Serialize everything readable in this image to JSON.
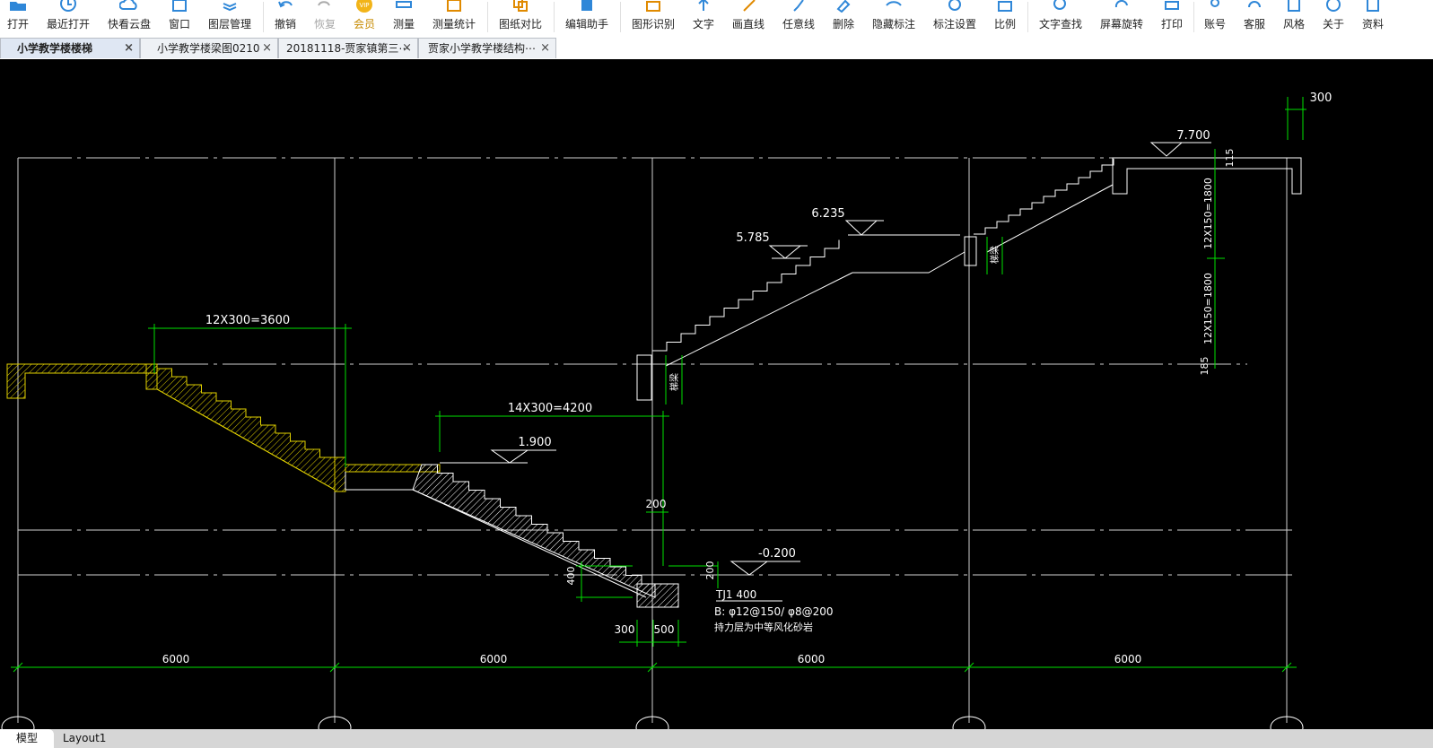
{
  "toolbar": {
    "open": "打开",
    "recent": "最近打开",
    "cloud": "快看云盘",
    "window": "窗口",
    "layers": "图层管理",
    "undo": "撤销",
    "redo": "恢复",
    "vip": "会员",
    "measure": "测量",
    "measure_stats": "测量统计",
    "compare": "图纸对比",
    "edit_assistant": "编辑助手",
    "shape_recognize": "图形识别",
    "text": "文字",
    "line": "画直线",
    "freeline": "任意线",
    "delete": "删除",
    "hide_dim": "隐藏标注",
    "dim_settings": "标注设置",
    "scale": "比例",
    "text_search": "文字查找",
    "rotate": "屏幕旋转",
    "print": "打印",
    "account": "账号",
    "service": "客服",
    "style": "风格",
    "about": "关于",
    "resources": "资料",
    "vip_badge": "VIP"
  },
  "tabs": [
    {
      "label": "小学教学楼楼梯",
      "close": "×"
    },
    {
      "label": "小学教学楼梁图0210",
      "close": "×"
    },
    {
      "label": "20181118-贾家镇第三⋯",
      "close": "×"
    },
    {
      "label": "贾家小学教学楼结构⋯",
      "close": "×"
    }
  ],
  "drawing": {
    "colors": {
      "background": "#000000",
      "axis": "#ffffff",
      "dim": "#00e000",
      "hatch": "#e0d000"
    },
    "dim_12x300": "12X300=3600",
    "dim_14x300": "14X300=4200",
    "lvl_1900": "1.900",
    "lvl_m0200": "-0.200",
    "lvl_5785": "5.785",
    "lvl_6235": "6.235",
    "lvl_7700": "7.700",
    "dim_300_top": "300",
    "dim_115": "115",
    "dim_12x150_a": "12X150=1800",
    "dim_12x150_b": "12X150=1800",
    "dim_185": "185",
    "dim_200_a": "200",
    "dim_200_b": "200",
    "dim_400": "400",
    "dim_300_bottom": "300",
    "dim_500": "500",
    "label_tl": "梯梁",
    "label_tl2": "梯梁",
    "tj_label": "TJ1 400",
    "tj_rebar": "B: φ12@150/ φ8@200",
    "tj_note": "持力层为中等风化砂岩",
    "span_1": "6000",
    "span_2": "6000",
    "span_3": "6000",
    "span_4": "6000"
  },
  "bottom_tabs": {
    "model": "模型",
    "layout": "Layout1"
  }
}
